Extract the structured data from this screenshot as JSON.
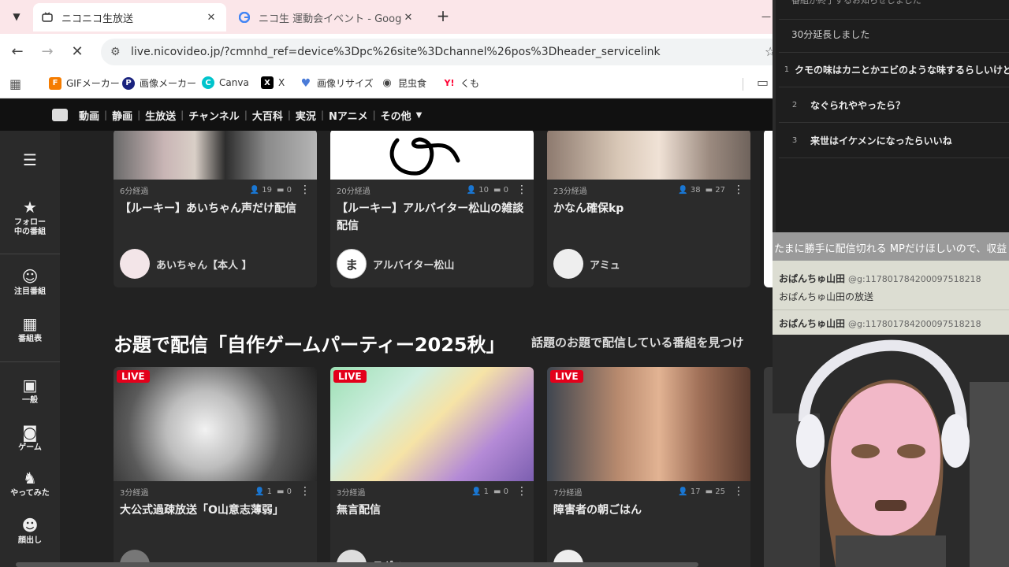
{
  "browser": {
    "tabs": [
      {
        "title": "ニコニコ生放送",
        "favicon": "nico-tv-icon",
        "active": true
      },
      {
        "title": "ニコ生 運動会イベント - Google 検",
        "favicon": "google-icon",
        "active": false
      }
    ],
    "url": "live.nicovideo.jp/?cmnhd_ref=device%3Dpc%26site%3Dchannel%26pos%3Dheader_servicelink",
    "bookmarks": [
      {
        "label": "GIFメーカー",
        "icon": "gif-maker-icon",
        "color": "#f57c00"
      },
      {
        "label": "画像メーカー",
        "icon": "image-maker-icon",
        "color": "#1a237e"
      },
      {
        "label": "Canva",
        "icon": "canva-icon",
        "color": "#00c4cc"
      },
      {
        "label": "X",
        "icon": "x-icon",
        "color": "#000000"
      },
      {
        "label": "画像リサイズ",
        "icon": "heart-icon",
        "color": "#4a7bd8"
      },
      {
        "label": "昆虫食",
        "icon": "eye-icon",
        "color": "#444444"
      },
      {
        "label": "くも",
        "icon": "yahoo-icon",
        "color": "#ff0033"
      }
    ]
  },
  "nico_header": {
    "links": [
      "動画",
      "静画",
      "生放送",
      "チャンネル",
      "大百科",
      "実況",
      "Nアニメ",
      "その他"
    ]
  },
  "left_nav": [
    {
      "label": "",
      "icon": "hamburger-icon"
    },
    {
      "label": "フォロー\n中の番組",
      "icon": "star-icon"
    },
    {
      "label": "注目番組",
      "icon": "attention-icon"
    },
    {
      "label": "番組表",
      "icon": "schedule-icon"
    },
    {
      "label": "一般",
      "icon": "chat-icon"
    },
    {
      "label": "ゲーム",
      "icon": "gamepad-icon"
    },
    {
      "label": "やってみた",
      "icon": "runner-icon"
    },
    {
      "label": "顔出し",
      "icon": "face-icon"
    }
  ],
  "row1": [
    {
      "elapsed": "6分経過",
      "viewers": "19",
      "comments": "0",
      "title": "【ルーキー】あいちゃん声だけ配信",
      "owner": "あいちゃん【本人 】"
    },
    {
      "elapsed": "20分経過",
      "viewers": "10",
      "comments": "0",
      "title": "【ルーキー】アルバイター松山の雑談配信",
      "owner": "アルバイター松山",
      "owner_initial": "ま"
    },
    {
      "elapsed": "23分経過",
      "viewers": "38",
      "comments": "27",
      "title": "かなん確保kp",
      "owner": "アミュ"
    }
  ],
  "section": {
    "title": "お題で配信「自作ゲームパーティー2025秋」",
    "subtitle": "話題のお題で配信している番組を見つけ"
  },
  "row2": [
    {
      "live": "LIVE",
      "elapsed": "3分経過",
      "viewers": "1",
      "comments": "0",
      "title": "大公式過疎放送「O山意志薄弱」",
      "owner": ""
    },
    {
      "live": "LIVE",
      "elapsed": "3分経過",
      "viewers": "1",
      "comments": "0",
      "title": "無言配信",
      "owner": "スギハ"
    },
    {
      "live": "LIVE",
      "elapsed": "7分経過",
      "viewers": "17",
      "comments": "25",
      "title": "障害者の朝ごはん",
      "owner": ""
    }
  ],
  "overlay": {
    "cut_text": "番組が終了するお知らせしました",
    "extension": "30分延長しました",
    "comments": [
      {
        "num": "1",
        "text": "クモの味はカニとかエビのような味するらしいけど"
      },
      {
        "num": "2",
        "text": "なぐられややったら？"
      },
      {
        "num": "3",
        "text": "来世はイケメンになったらいいね"
      }
    ]
  },
  "chat": {
    "ticker": "たまに勝手に配信切れる MPだけほしいので、収益",
    "messages": [
      {
        "name": "おぱんちゅ山田",
        "id": "@g:117801784200097518218",
        "text": "おぱんちゅ山田の放送"
      },
      {
        "name": "おぱんちゅ山田",
        "id": "@g:117801784200097518218",
        "text": ""
      }
    ]
  },
  "colors": {
    "live_badge": "#e3001b",
    "tab_bar": "#fbe6e9",
    "page_bg": "#222222"
  }
}
